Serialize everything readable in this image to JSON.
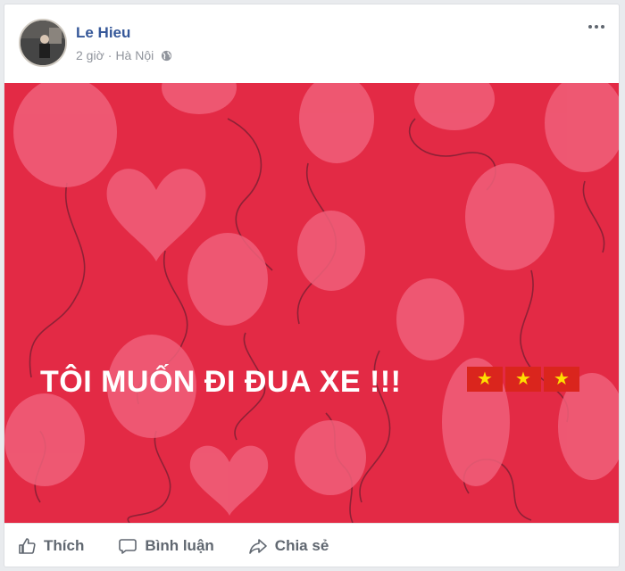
{
  "post": {
    "author": "Le Hieu",
    "time": "2 giờ",
    "separator": "·",
    "location": "Hà Nội",
    "text": "TÔI MUỐN ĐI ĐUA XE !!!",
    "flag_star": "★"
  },
  "actions": {
    "like": "Thích",
    "comment": "Bình luận",
    "share": "Chia sẻ"
  },
  "colors": {
    "background_red": "#e32a45",
    "balloon": "#f0607a",
    "author_link": "#365899",
    "flag_red": "#da251d",
    "flag_star": "#ffde00"
  },
  "icons": [
    "globe-icon",
    "more-options-icon",
    "like-icon",
    "comment-icon",
    "share-icon",
    "flag-icon"
  ]
}
